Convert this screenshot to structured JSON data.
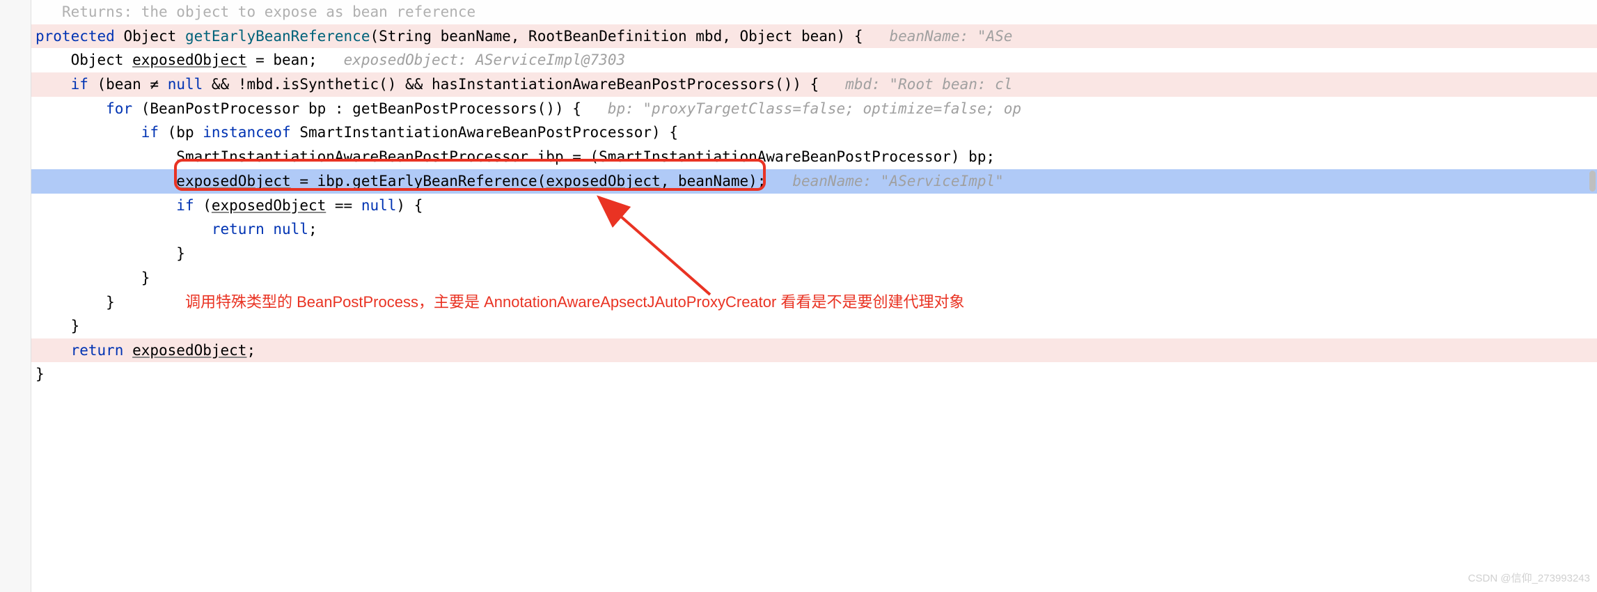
{
  "doc_comment": "Returns: the object to expose as bean reference",
  "code": {
    "kw_protected": "protected",
    "type_object": "Object",
    "method_name": "getEarlyBeanReference",
    "sig_params": "(String beanName, RootBeanDefinition mbd, Object bean) {",
    "hint_beanName_sig": "beanName: \"ASe",
    "line2_prefix": "Object ",
    "line2_var": "exposedObject",
    "line2_suffix": " = bean;",
    "hint_exposedObject": "exposedObject: AServiceImpl@7303",
    "kw_if": "if",
    "line3_cond1": " (bean ",
    "line3_ne": "≠",
    "line3_null": " null",
    "line3_cond2": " && !mbd.isSynthetic() && hasInstantiationAwareBeanPostProcessors()) {",
    "hint_mbd": "mbd: \"Root bean: cl",
    "kw_for": "for",
    "line4_for": " (BeanPostProcessor bp : getBeanPostProcessors()) {",
    "hint_bp": "bp: \"proxyTargetClass=false; optimize=false; op",
    "line5_if": " (bp ",
    "kw_instanceof": "instanceof",
    "line5_type": " SmartInstantiationAwareBeanPostProcessor) {",
    "line6": "SmartInstantiationAwareBeanPostProcessor ibp = (SmartInstantiationAwareBeanPostProcessor) bp;",
    "line7_var": "exposedObject",
    "line7_mid": " = ibp.getEarlyBeanReference(",
    "line7_arg": "exposedObject",
    "line7_end": ", beanName);",
    "hint_beanName2": "beanName: \"AServiceImpl\"",
    "line8_if": " (",
    "line8_var": "exposedObject",
    "line8_eq": " == ",
    "line8_null": "null",
    "line8_end": ") {",
    "kw_return": "return",
    "line9_null": " null",
    "line9_semi": ";",
    "brace_close": "}",
    "line_return": "return ",
    "line_return_var": "exposedObject",
    "line_return_semi": ";"
  },
  "annotation": "调用特殊类型的 BeanPostProcess，主要是 AnnotationAwareApsectJAutoProxyCreator 看看是不是要创建代理对象",
  "watermark": "CSDN @信仰_273993243"
}
